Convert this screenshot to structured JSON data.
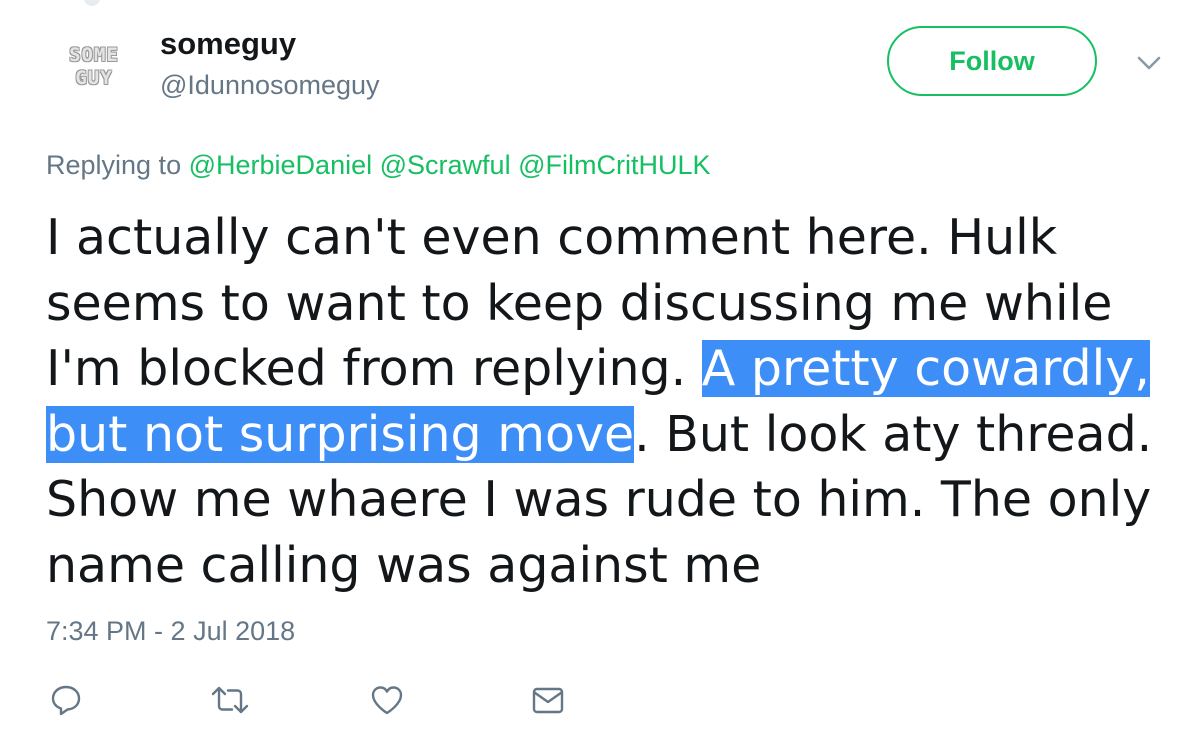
{
  "author": {
    "avatar_line1": "SOME",
    "avatar_line2": "GUY",
    "display_name": "someguy",
    "handle": "@Idunnosomeguy"
  },
  "follow_button": {
    "label": "Follow",
    "color": "#17bf63"
  },
  "replying": {
    "prefix": "Replying to",
    "mentions": [
      "@HerbieDaniel",
      "@Scrawful",
      "@FilmCritHULK"
    ]
  },
  "tweet": {
    "text_before_highlight": "I actually can't even comment here. Hulk seems to want to keep discussing me while I'm blocked from replying. ",
    "highlighted_text": "A pretty cowardly, but not surprising move",
    "text_after_highlight": ". But look aty thread. Show me whaere I was rude to him. The only name calling was against me",
    "highlight_color": "#3e8ef7"
  },
  "timestamp": "7:34 PM - 2 Jul 2018",
  "actions": [
    {
      "name": "reply",
      "icon": "reply-icon"
    },
    {
      "name": "retweet",
      "icon": "retweet-icon"
    },
    {
      "name": "like",
      "icon": "heart-icon"
    },
    {
      "name": "direct-message",
      "icon": "envelope-icon"
    }
  ]
}
